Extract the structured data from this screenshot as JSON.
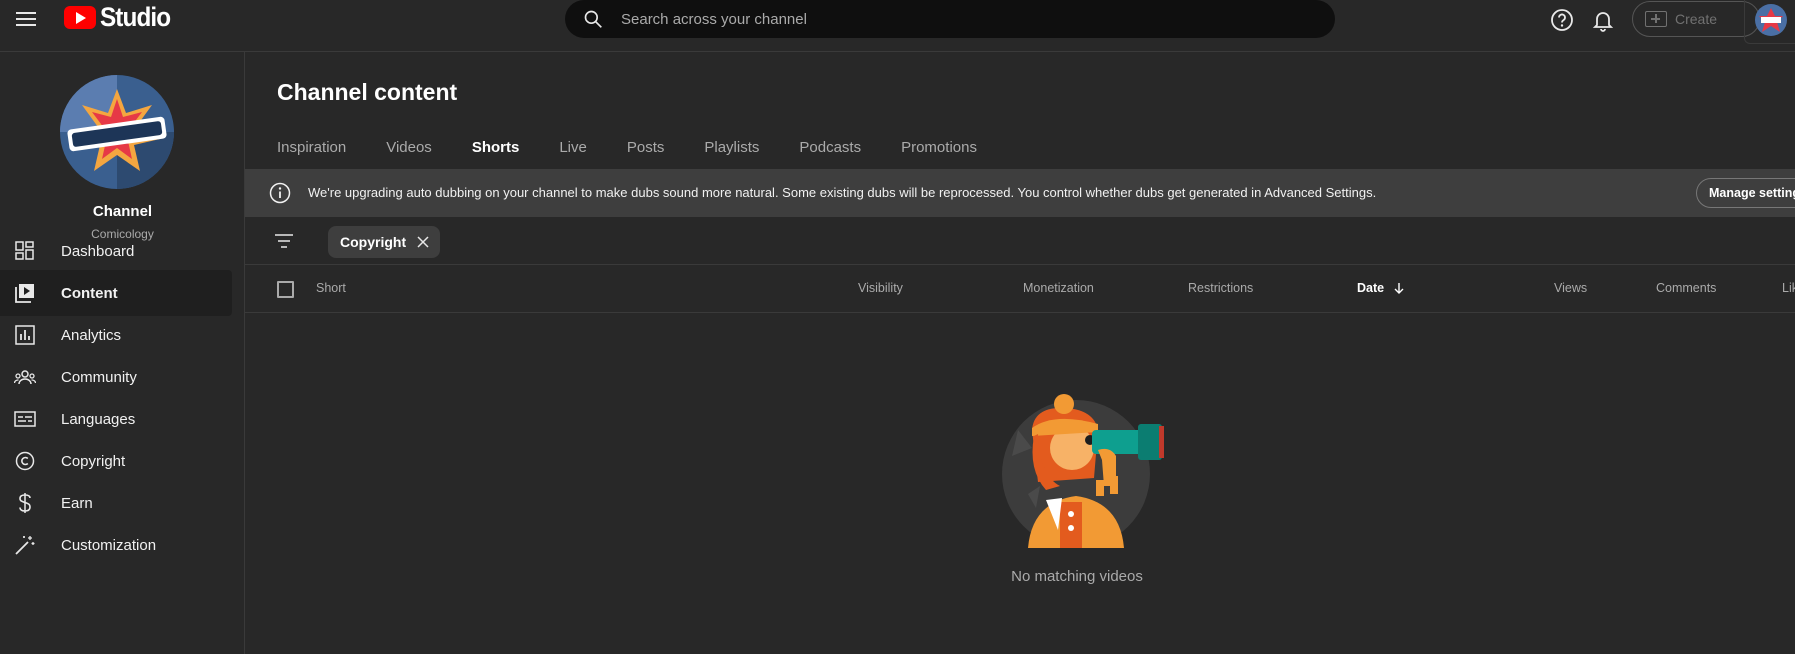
{
  "app": {
    "logo_text": "Studio"
  },
  "search": {
    "placeholder": "Search across your channel"
  },
  "topbar": {
    "create_label": "Create"
  },
  "channel": {
    "title": "Channel",
    "name": "Comicology"
  },
  "sidebar": {
    "items": [
      {
        "label": "Dashboard",
        "icon": "dashboard-icon"
      },
      {
        "label": "Content",
        "icon": "content-icon",
        "active": true
      },
      {
        "label": "Analytics",
        "icon": "analytics-icon"
      },
      {
        "label": "Community",
        "icon": "community-icon"
      },
      {
        "label": "Languages",
        "icon": "languages-icon"
      },
      {
        "label": "Copyright",
        "icon": "copyright-icon"
      },
      {
        "label": "Earn",
        "icon": "dollar-icon"
      },
      {
        "label": "Customization",
        "icon": "magic-wand-icon"
      }
    ]
  },
  "main": {
    "title": "Channel content",
    "tabs": [
      {
        "label": "Inspiration"
      },
      {
        "label": "Videos"
      },
      {
        "label": "Shorts",
        "active": true
      },
      {
        "label": "Live"
      },
      {
        "label": "Posts"
      },
      {
        "label": "Playlists"
      },
      {
        "label": "Podcasts"
      },
      {
        "label": "Promotions"
      }
    ],
    "banner": {
      "message": "We're upgrading auto dubbing on your channel to make dubs sound more natural. Some existing dubs will be reprocessed. You control whether dubs get generated in Advanced Settings.",
      "button": "Manage settings"
    },
    "filter_chip": "Copyright",
    "table": {
      "columns": [
        "Short",
        "Visibility",
        "Monetization",
        "Restrictions",
        "Date",
        "Views",
        "Comments",
        "Likes"
      ],
      "sorted_column": "Date",
      "sort_direction": "descending"
    },
    "empty_state": "No matching videos"
  },
  "colors": {
    "background": "#282828",
    "brand_red": "#ff0000",
    "search_bg": "#0f0f0f",
    "banner_bg": "#3e3e3e"
  }
}
